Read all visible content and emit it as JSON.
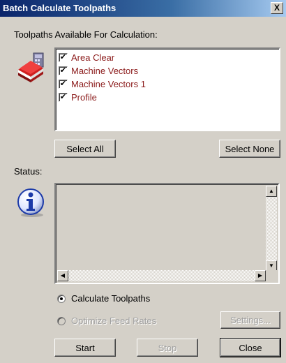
{
  "window": {
    "title": "Batch Calculate Toolpaths",
    "close_glyph": "X"
  },
  "toolpaths": {
    "heading": "Toolpaths Available For Calculation:",
    "items": [
      {
        "label": "Area Clear",
        "checked": true
      },
      {
        "label": "Machine Vectors",
        "checked": true
      },
      {
        "label": "Machine Vectors 1",
        "checked": true
      },
      {
        "label": "Profile",
        "checked": true
      }
    ],
    "check_glyph": "✔",
    "select_all_label": "Select All",
    "select_none_label": "Select None"
  },
  "status": {
    "label": "Status:",
    "icon": "information-icon",
    "text": ""
  },
  "options": {
    "calculate_label": "Calculate Toolpaths",
    "calculate_selected": true,
    "optimize_label": "Optimize Feed Rates",
    "optimize_enabled": false,
    "settings_label": "Settings..."
  },
  "actions": {
    "start_label": "Start",
    "stop_label": "Stop",
    "close_label": "Close"
  },
  "colors": {
    "title_bar": "#0a246a",
    "item_text": "#8b1a1a",
    "dialog_bg": "#d4d0c8"
  }
}
